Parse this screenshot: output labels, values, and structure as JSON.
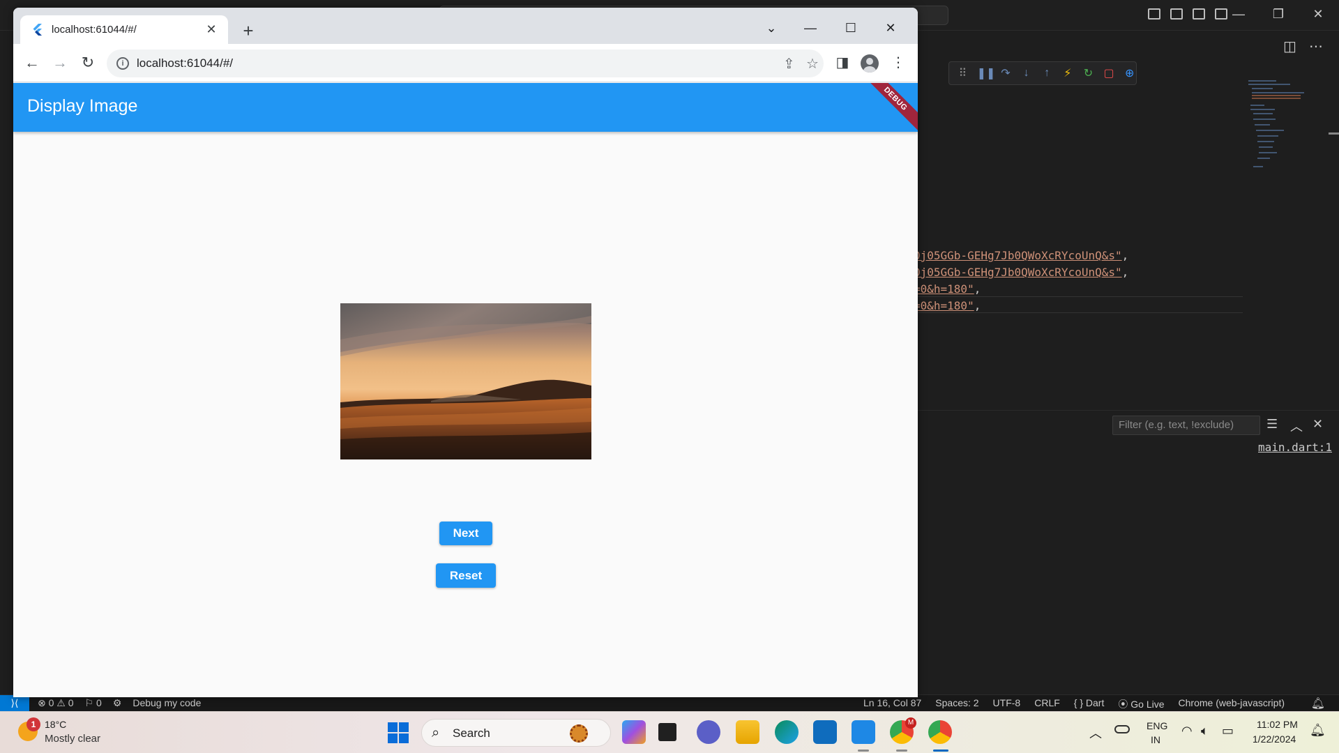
{
  "chrome": {
    "tab_title": "localhost:61044/#/",
    "url": "localhost:61044/#/",
    "close_tab": "✕",
    "new_tab": "+"
  },
  "app": {
    "title": "Display Image",
    "debug_banner": "DEBUG",
    "next_label": "Next",
    "reset_label": "Reset",
    "primary_color": "#2196f3"
  },
  "vscode": {
    "code_lines": [
      {
        "str": "0j05GGb-GEHg7Jb0QWoXcRYcoUnQ&s\"",
        "punc": ","
      },
      {
        "str": "0j05GGb-GEHg7Jb0QWoXcRYcoUnQ&s\"",
        "punc": ","
      },
      {
        "str": "=0&h=180\"",
        "punc": ","
      },
      {
        "str": "=0&h=180\"",
        "punc": ","
      }
    ],
    "filter_placeholder": "Filter (e.g. text, !exclude)",
    "output_link": "main.dart:1",
    "status": {
      "problems": "⊗ 0 ⚠ 0",
      "ports": "⚐ 0",
      "debug_label": "Debug my code",
      "position": "Ln 16, Col 87",
      "spaces": "Spaces: 2",
      "encoding": "UTF-8",
      "eol": "CRLF",
      "language": "{ } Dart",
      "golive": "Go Live",
      "target": "Chrome (web-javascript)"
    }
  },
  "taskbar": {
    "weather_temp": "18°C",
    "weather_desc": "Mostly clear",
    "weather_badge": "1",
    "search_label": "Search",
    "lang_1": "ENG",
    "lang_2": "IN",
    "time": "11:02 PM",
    "date": "1/22/2024",
    "chrome_badge": "M"
  }
}
